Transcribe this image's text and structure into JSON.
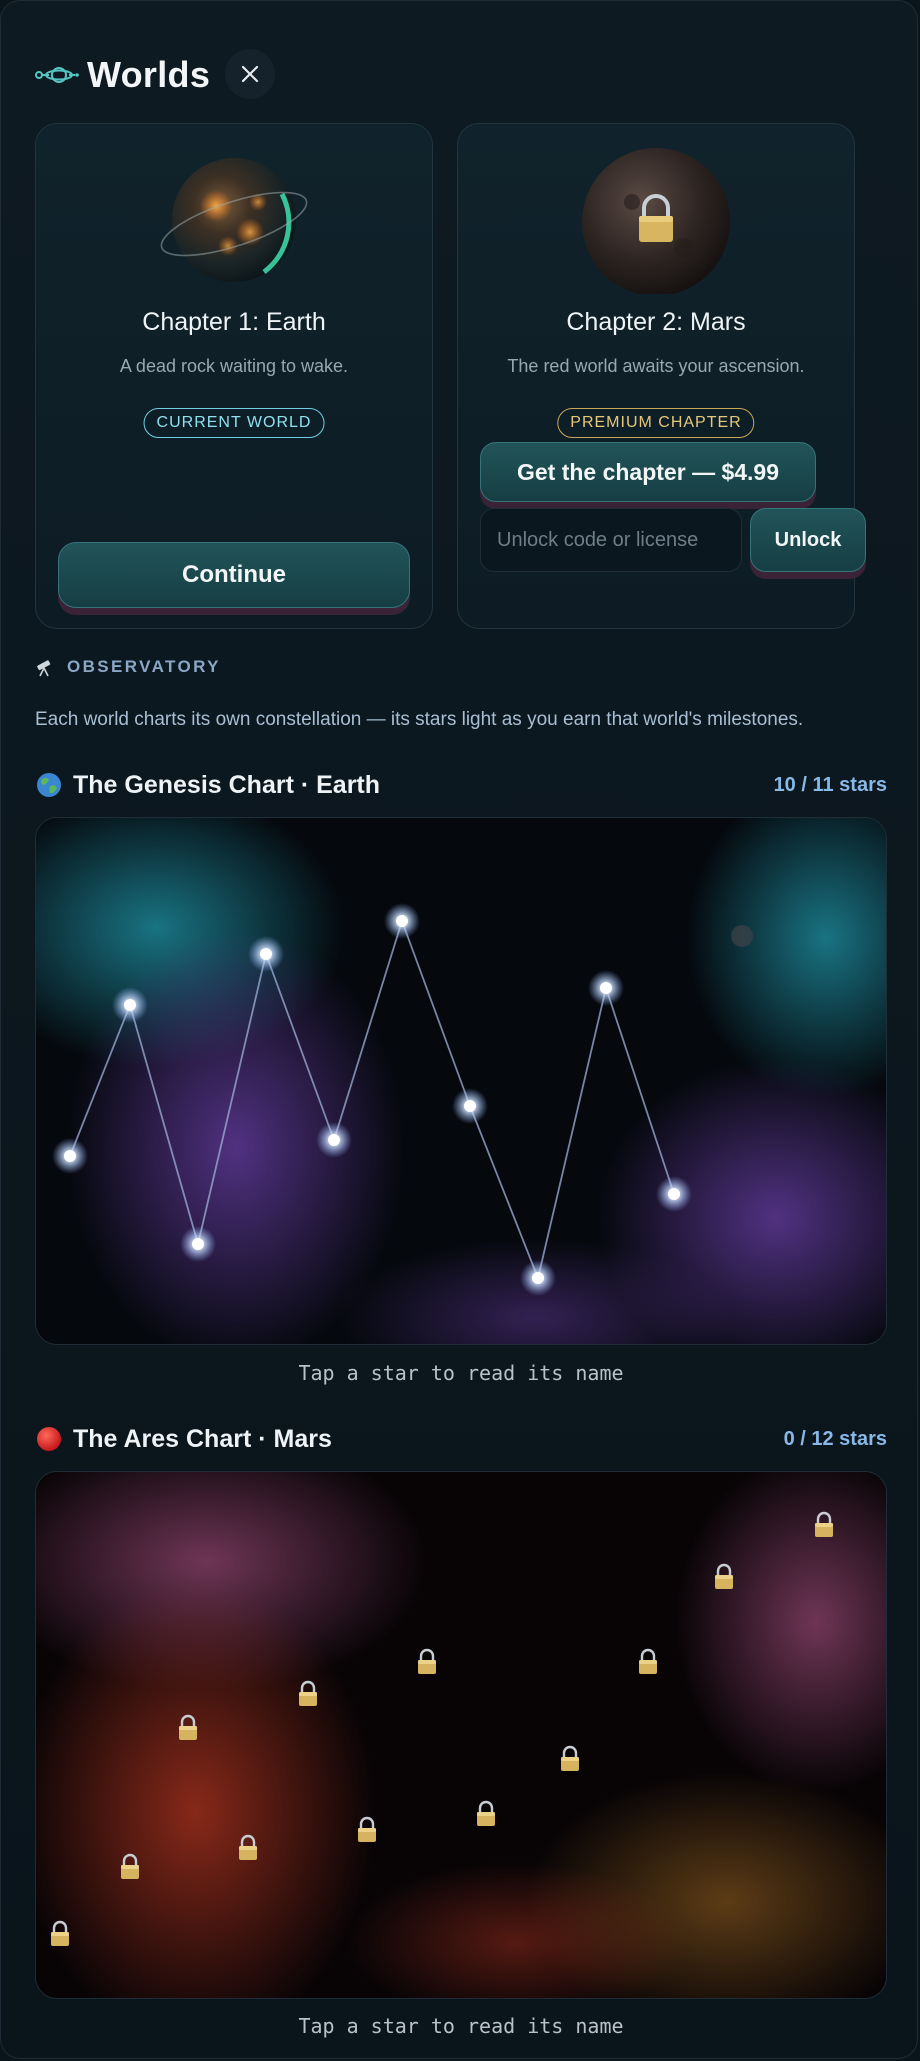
{
  "header": {
    "title": "Worlds"
  },
  "chapters": [
    {
      "title": "Chapter 1: Earth",
      "description": "A dead rock waiting to wake.",
      "badge": "CURRENT WORLD",
      "action": "Continue"
    },
    {
      "title": "Chapter 2: Mars",
      "description": "The red world awaits your ascension.",
      "badge": "PREMIUM CHAPTER",
      "buy_label": "Get the chapter — $4.99",
      "code_placeholder": "Unlock code or license",
      "unlock_label": "Unlock"
    }
  ],
  "observatory": {
    "label": "OBSERVATORY",
    "description": "Each world charts its own constellation — its stars light as you earn that world's milestones."
  },
  "constellations": [
    {
      "emoji": "🌍",
      "title": "The Genesis Chart · Earth",
      "count": "10 / 11 stars",
      "hint": "Tap a star to read its name",
      "lit_stars": 10,
      "total_stars": 11
    },
    {
      "emoji": "🔴",
      "title": "The Ares Chart · Mars",
      "count": "0 / 12 stars",
      "hint": "Tap a star to read its name",
      "lit_stars": 0,
      "total_stars": 12
    }
  ],
  "colors": {
    "background": "#0a141b",
    "accent_teal": "#6fcfe0",
    "premium_gold": "#c9a656",
    "count_blue": "#87b8e6"
  },
  "icons": {
    "logo": "orbit-logo-icon",
    "close": "close-icon",
    "observatory": "telescope-icon",
    "locked_star": "padlock-icon"
  }
}
